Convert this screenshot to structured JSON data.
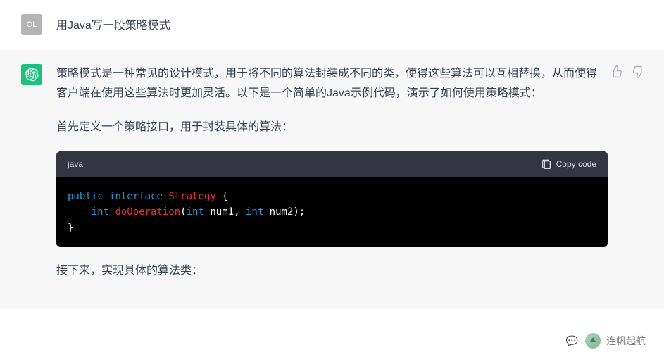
{
  "user": {
    "avatar_text": "OL",
    "message": "用Java写一段策略模式"
  },
  "assistant": {
    "paragraph1": "策略模式是一种常见的设计模式，用于将不同的算法封装成不同的类，使得这些算法可以互相替换，从而使得客户端在使用这些算法时更加灵活。以下是一个简单的Java示例代码，演示了如何使用策略模式：",
    "paragraph2": "首先定义一个策略接口，用于封装具体的算法：",
    "paragraph3": "接下来，实现具体的算法类：",
    "code": {
      "language": "java",
      "copy_label": "Copy code",
      "tokens": {
        "public": "public",
        "interface": "interface",
        "strategy": "Strategy",
        "int": "int",
        "doOperation": "doOperation",
        "num1": "num1",
        "num2": "num2"
      }
    }
  },
  "watermark": {
    "channel": "连帆起航"
  }
}
